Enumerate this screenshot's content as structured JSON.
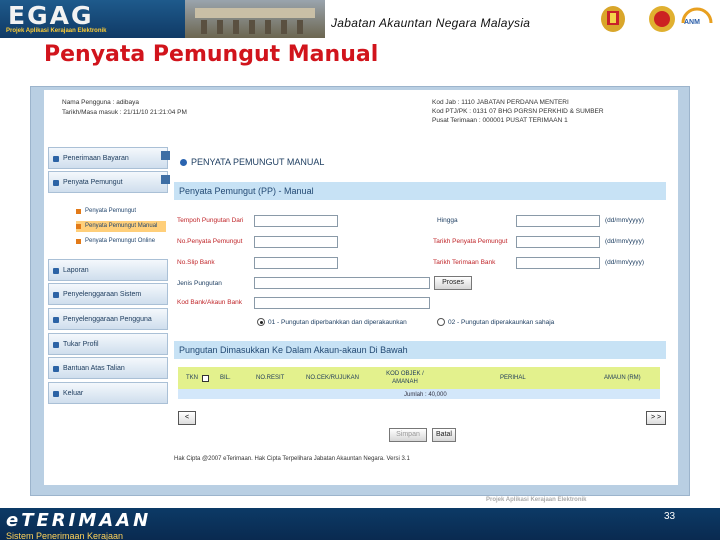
{
  "banner": {
    "logo": "EGAG",
    "logo_sub": "Projek Aplikasi Kerajaan Elektronik",
    "department": "Jabatan Akauntan Negara Malaysia",
    "anm": "ANM"
  },
  "page_title": "Penyata Pemungut Manual",
  "header": {
    "left_line1": "Nama Pengguna : adibaya",
    "left_line2": "Tarikh/Masa masuk : 21/11/10 21:21:04 PM",
    "right_line1": "Kod Jab : 1110 JABATAN PERDANA MENTERI",
    "right_line2": "Kod PTJ/PK : 0131 07 BHG PGRSN PERKHID & SUMBER",
    "right_line3": "Pusat Terimaan : 000001 PUSAT TERIMAAN 1"
  },
  "sidebar": {
    "items": [
      {
        "label": "Penerimaan Bayaran"
      },
      {
        "label": "Penyata Pemungut"
      },
      {
        "label": "Laporan"
      },
      {
        "label": "Penyelenggaraan Sistem"
      },
      {
        "label": "Penyelenggaraan Pengguna"
      },
      {
        "label": "Tukar Profil"
      },
      {
        "label": "Bantuan Atas Talian"
      },
      {
        "label": "Keluar"
      }
    ],
    "sub_items": [
      {
        "label": "Penyata Pemungut"
      },
      {
        "label": "Penyata Pemungut Manual"
      },
      {
        "label": "Penyata Pemungut Online"
      }
    ]
  },
  "main": {
    "title": "PENYATA PEMUNGUT MANUAL",
    "section1": "Penyata Pemungut (PP) - Manual",
    "section2": "Pungutan Dimasukkan Ke Dalam Akaun-akaun Di Bawah",
    "form": {
      "l1": "Tempoh Pungutan Dari",
      "l2": "No.Penyata Pemungut",
      "l3": "No.Slip Bank",
      "l4": "Jenis Pungutan",
      "l5": "Kod Bank/Akaun Bank",
      "r1": "Hingga",
      "r2": "Tarikh Penyata Pemungut",
      "r3": "Tarikh Terimaan Bank",
      "hint": "(dd/mm/yyyy)",
      "proses": "Proses",
      "radio1": "01 - Pungutan diperbankkan dan diperakaunkan",
      "radio2": "02 - Pungutan diperakaunkan sahaja"
    },
    "table": {
      "headers": [
        "TKN",
        "BIL.",
        "NO.RESIT",
        "NO.CEK/RUJUKAN",
        "KOD OBJEK / AMANAH",
        "PERIHAL",
        "AMAUN (RM)"
      ],
      "jumlah": "Jumlah : 40,000"
    },
    "simpan": "Simpan",
    "batal": "Batal",
    "pager_prev": "<",
    "pager_next": "> >",
    "copyright": "Hak Cipta @2007 eTerimaan. Hak Cipta Terpelihara Jabatan Akauntan Negara. Versi 3.1"
  },
  "footer": {
    "proj": "Projek Aplikasi Kerajaan Elektronik",
    "logo": "eTERIMAAN",
    "sub": "Sistem Penerimaan Kerajaan",
    "page_no": "33"
  }
}
